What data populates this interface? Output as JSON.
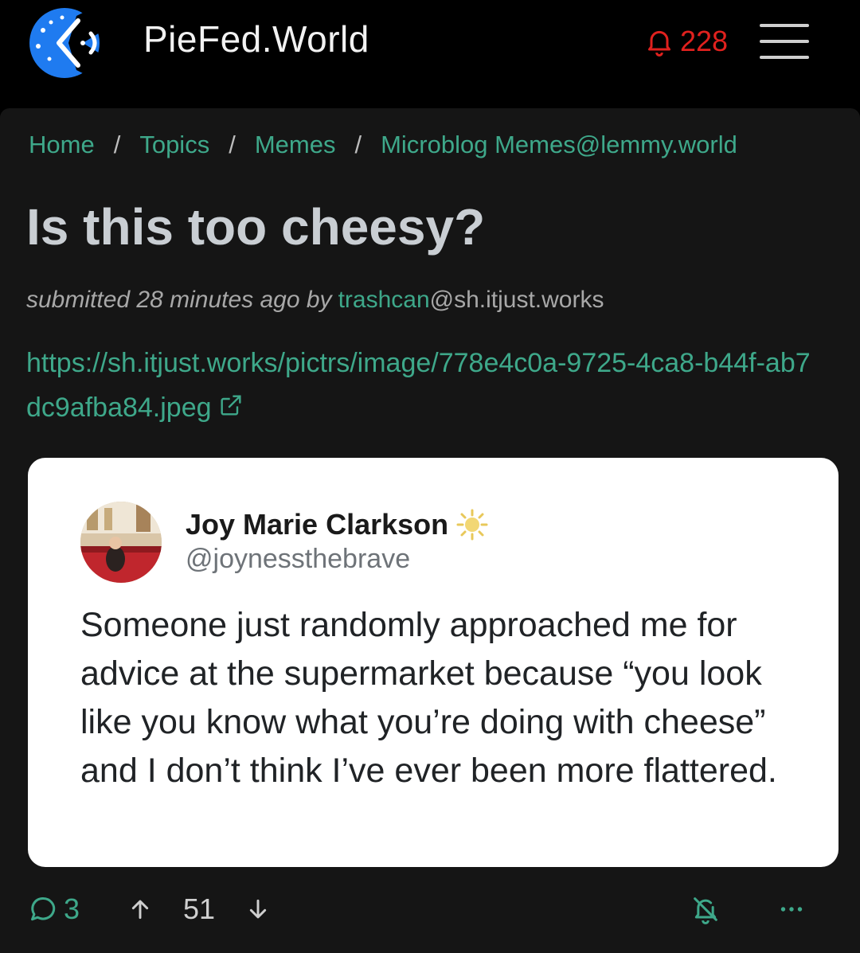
{
  "header": {
    "site_title": "PieFed.World",
    "notification_count": "228",
    "bell_color": "#e0211e",
    "logo_color": "#1f7bf0"
  },
  "breadcrumb": {
    "items": [
      "Home",
      "Topics",
      "Memes",
      "Microblog Memes@lemmy.world"
    ],
    "separator": "/"
  },
  "post": {
    "title": "Is this too cheesy?",
    "submitted_text": "submitted 28 minutes ago by",
    "author_user": "trashcan",
    "author_instance": "@sh.itjust.works",
    "link_url": "https://sh.itjust.works/pictrs/image/778e4c0a-9725-4ca8-b44f-ab7dc9afba84.jpeg",
    "link_icon": "external-link-icon"
  },
  "embedded_tweet": {
    "display_name": "Joy Marie Clarkson",
    "name_emoji": "sun-icon",
    "handle": "@joynessthebrave",
    "text": "Someone just randomly approached me for advice at the supermarket because “you look like you know what you’re doing with cheese” and I don’t think I’ve ever been more flattered."
  },
  "actions": {
    "comment_count": "3",
    "score": "51",
    "accent_color": "#3ea88a"
  }
}
